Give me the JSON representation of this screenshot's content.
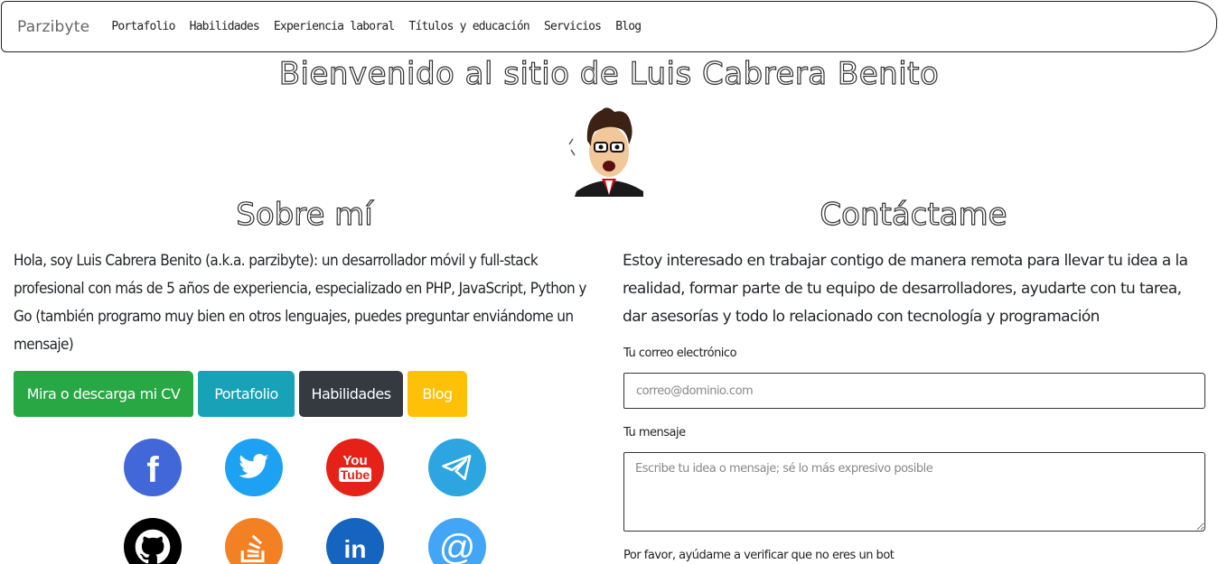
{
  "navbar": {
    "brand": "Parzibyte",
    "links": [
      "Portafolio",
      "Habilidades",
      "Experiencia laboral",
      "Títulos y educación",
      "Servicios",
      "Blog"
    ]
  },
  "header": {
    "title": "Bienvenido al sitio de Luis Cabrera Benito"
  },
  "about": {
    "title": "Sobre mí",
    "text": "Hola, soy Luis Cabrera Benito (a.k.a. parzibyte): un desarrollador móvil y full-stack profesional con más de 5 años de experiencia, especializado en PHP, JavaScript, Python y Go (también programo muy bien en otros lenguajes, puedes preguntar enviándome un mensaje)",
    "buttons": {
      "cv": "Mira o descarga mi CV",
      "portfolio": "Portafolio",
      "skills": "Habilidades",
      "blog": "Blog"
    }
  },
  "social": {
    "icons": [
      "facebook-icon",
      "twitter-icon",
      "youtube-icon",
      "telegram-icon",
      "github-icon",
      "stackoverflow-icon",
      "linkedin-icon",
      "email-icon"
    ],
    "youtube_text_top": "You",
    "youtube_text_bottom": "Tube",
    "linkedin_text": "in",
    "email_text": "@",
    "facebook_text": "f"
  },
  "contact": {
    "title": "Contáctame",
    "text": "Estoy interesado en trabajar contigo de manera remota para llevar tu idea a la realidad, formar parte de tu equipo de desarrolladores, ayudarte con tu tarea, dar asesorías y todo lo relacionado con tecnología y programación",
    "email_label": "Tu correo electrónico",
    "email_placeholder": "correo@dominio.com",
    "message_label": "Tu mensaje",
    "message_placeholder": "Escribe tu idea o mensaje; sé lo más expresivo posible",
    "bot_label": "Por favor, ayúdame a verificar que no eres un bot"
  },
  "colors": {
    "facebook": "#4267d9",
    "twitter": "#1da1f2",
    "youtube": "#e62117",
    "telegram": "#2ca5e0",
    "github": "#000000",
    "stackoverflow": "#f48024",
    "linkedin": "#1565c0",
    "email": "#42a5f5"
  }
}
